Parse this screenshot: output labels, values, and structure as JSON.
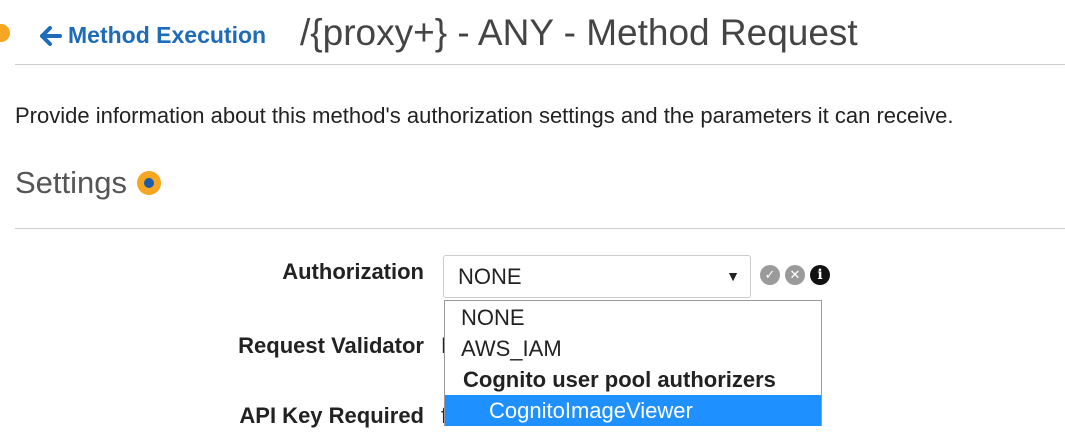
{
  "header": {
    "back_label": "Method Execution",
    "title": "/{proxy+} - ANY - Method Request"
  },
  "description": "Provide information about this method's authorization settings and the parameters it can receive.",
  "section": {
    "title": "Settings"
  },
  "fields": {
    "authorization_label": "Authorization",
    "authorization_value": "NONE",
    "request_validator_label": "Request Validator",
    "api_key_required_label": "API Key Required",
    "validator_partial": "N",
    "apikey_partial": "f"
  },
  "dropdown": {
    "options": [
      "NONE",
      "AWS_IAM"
    ],
    "group_label": "Cognito user pool authorizers",
    "group_options": [
      "CognitoImageViewer"
    ],
    "highlighted": "CognitoImageViewer"
  },
  "icons": {
    "back": "arrow-left-icon",
    "settings": "settings-status-icon",
    "confirm": "check-circle-icon",
    "cancel": "x-circle-icon",
    "info": "info-circle-icon",
    "select_arrow": "caret-down-icon"
  },
  "colors": {
    "link": "#1e6bb8",
    "accent_orange": "#f5a623",
    "highlight": "#1e90ff"
  }
}
